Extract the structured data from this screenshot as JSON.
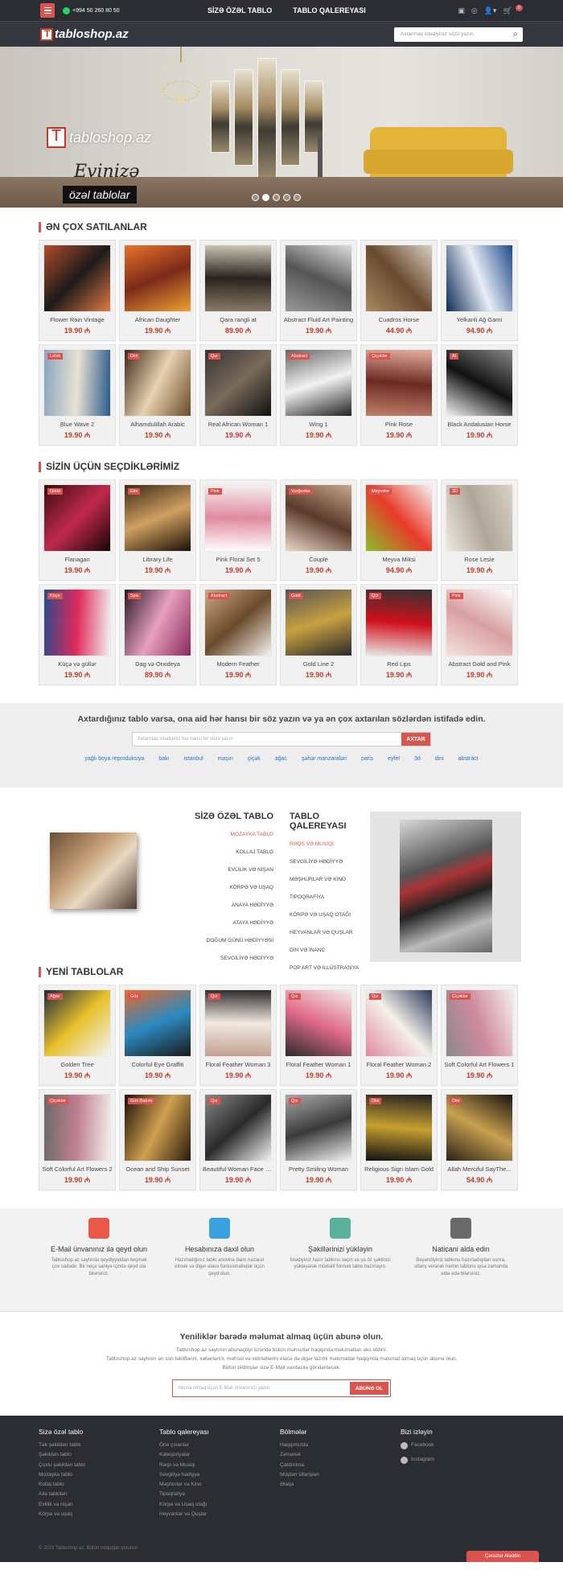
{
  "topbar": {
    "phone": "+994 50 260 80 50",
    "nav": [
      "SİZƏ ÖZƏL TABLO",
      "TABLO QALEREYASI"
    ],
    "cart_count": "0"
  },
  "header": {
    "logo_text": "tabloshop.az",
    "search_placeholder": "Axtarmaq istədiyiniz sözü yazın."
  },
  "hero": {
    "logo_text": "tabloshop.az",
    "line1": "Evinizə",
    "line2": "özəl tablolar"
  },
  "bestsellers": {
    "title": "ƏN ÇOX SATILANLAR",
    "products": [
      {
        "name": "Flower Rain Vintage",
        "price": "19.90 ₼",
        "badge": "",
        "colors": [
          "#b34a2a",
          "#1c1b1a",
          "#e07a44"
        ]
      },
      {
        "name": "African Daughter",
        "price": "19.90 ₼",
        "badge": "",
        "colors": [
          "#e8722a",
          "#7b2a1a",
          "#f0a030"
        ]
      },
      {
        "name": "Qara rangli at",
        "price": "89.90 ₼",
        "badge": "",
        "colors": [
          "#cfc7b6",
          "#2a231d",
          "#8a7a66"
        ]
      },
      {
        "name": "Abstract Fluid Art Painting",
        "price": "19.90 ₼",
        "badge": "",
        "colors": [
          "#ddd",
          "#555",
          "#999"
        ]
      },
      {
        "name": "Cuadros Horse",
        "price": "44.90 ₼",
        "badge": "",
        "colors": [
          "#d8cfc2",
          "#6a4a2e",
          "#a88a62"
        ]
      },
      {
        "name": "Yelkanli Ağ Gami",
        "price": "94.90 ₼",
        "badge": "",
        "colors": [
          "#1f4a8a",
          "#e8eef6",
          "#0d2a55"
        ]
      },
      {
        "name": "Blue Wave 2",
        "price": "19.90 ₼",
        "badge": "Lələk",
        "colors": [
          "#2a5a8a",
          "#e8e2d2",
          "#8aa6c0"
        ]
      },
      {
        "name": "Alhamdulillah Arabic",
        "price": "19.90 ₼",
        "badge": "Dini",
        "colors": [
          "#6a4a2a",
          "#e8d2b0",
          "#3a2a1a"
        ]
      },
      {
        "name": "Real African Woman 1",
        "price": "19.90 ₼",
        "badge": "Qız",
        "colors": [
          "#111",
          "#7a6a5a",
          "#333"
        ]
      },
      {
        "name": "Wing 1",
        "price": "19.90 ₼",
        "badge": "Abstract",
        "colors": [
          "#222",
          "#f2f2f2",
          "#666"
        ]
      },
      {
        "name": "Pink Rose",
        "price": "19.90 ₼",
        "badge": "Çiçəklər",
        "colors": [
          "#c0806a",
          "#6a2a22",
          "#e8b0a0"
        ]
      },
      {
        "name": "Black Andalusian Horse",
        "price": "19.90 ₼",
        "badge": "At",
        "colors": [
          "#f4f4f4",
          "#111",
          "#888"
        ]
      }
    ]
  },
  "picks": {
    "title": "SİZİN ÜÇÜN SEÇDİKLƏRİMİZ",
    "products": [
      {
        "name": "Flanagan",
        "price": "19.90 ₼",
        "badge": "Orkid",
        "colors": [
          "#3a0a12",
          "#c02a4a",
          "#1a0508"
        ]
      },
      {
        "name": "Library Life",
        "price": "19.90 ₼",
        "badge": "Elm",
        "colors": [
          "#3a2a18",
          "#d0a060",
          "#1a1208"
        ]
      },
      {
        "name": "Pink Floral Set 5",
        "price": "19.90 ₼",
        "badge": "Pink",
        "colors": [
          "#f4f0ee",
          "#e08aa0",
          "#fff"
        ]
      },
      {
        "name": "Couple",
        "price": "19.90 ₼",
        "badge": "Vurğunlar",
        "colors": [
          "#c8a88a",
          "#5a3a2a",
          "#e8d8c8"
        ]
      },
      {
        "name": "Meyva Miksi",
        "price": "94.90 ₼",
        "badge": "Meyvələr",
        "colors": [
          "#f4f4f4",
          "#e83a2a",
          "#8ac02a"
        ]
      },
      {
        "name": "Rose Lesie",
        "price": "19.90 ₼",
        "badge": "3D",
        "colors": [
          "#d8d2c8",
          "#b0a698",
          "#ece8e2"
        ]
      },
      {
        "name": "Küçə və güllər",
        "price": "19.90 ₼",
        "badge": "Küçə",
        "colors": [
          "#f2f2f2",
          "#e02a5a",
          "#2a4a8a"
        ]
      },
      {
        "name": "Dag və Orxideya",
        "price": "89.90 ₼",
        "badge": "Spa",
        "colors": [
          "#8a2a5a",
          "#e8a0c0",
          "#2a1a2a"
        ]
      },
      {
        "name": "Modern Feather",
        "price": "19.90 ₼",
        "badge": "Abstract",
        "colors": [
          "#f4f2ee",
          "#6a4a2a",
          "#c8a888"
        ]
      },
      {
        "name": "Gold Line 2",
        "price": "19.90 ₼",
        "badge": "Gold",
        "colors": [
          "#2a2a2a",
          "#c8a040",
          "#555"
        ]
      },
      {
        "name": "Red Lips",
        "price": "19.90 ₼",
        "badge": "Qız",
        "colors": [
          "#e8e8e8",
          "#d0101a",
          "#333"
        ]
      },
      {
        "name": "Abstract Gold and Pink",
        "price": "19.90 ₼",
        "badge": "Pink",
        "colors": [
          "#f4e2de",
          "#d8a0a0",
          "#fff"
        ]
      }
    ]
  },
  "search_band": {
    "heading": "Axtardığınız tablo varsa, ona aid hər hansı bir söz yazın və ya ən çox axtarılan sözlərdən istifadə edin.",
    "placeholder": "Axtarmaq istədiyiniz hər hansı bir sözü yazın",
    "button": "AXTAR",
    "tags": [
      "yağlı boya reproduksiya",
      "bakı",
      "istanbul",
      "maşın",
      "çiçək",
      "ağac",
      "şəhər manzaraləri",
      "paris",
      "eyfel",
      "3d",
      "dini",
      "abstract"
    ]
  },
  "menus": {
    "col1_title": "SİZƏ ÖZƏL TABLO",
    "col1": [
      "MOZAYKA TABLO",
      "KOLLAJ TABLO",
      "EVLİLİK VƏ NİŞAN",
      "KÖRPƏ VƏ UŞAQ",
      "ANAYA HƏDİYYƏ",
      "ATAYA HƏDİYYƏ",
      "DOĞUM GÜNÜ HƏDİYYƏSİ",
      "SEVGİLİYƏ HƏDİYYƏ"
    ],
    "col2_title": "TABLO QALEREYASI",
    "col2": [
      "RƏQS VƏ MUSİQİ",
      "SEVGİLİYƏ HƏDİYYƏ",
      "MƏŞHURLAR VƏ KİNO",
      "TİPOQRAFİYA",
      "KÖRPƏ VƏ UŞAQ OTAĞI",
      "HEYVANLAR VƏ QUŞLAR",
      "DİN VƏ İNANC",
      "POP ART VƏ İLLÜSTRASİYA"
    ]
  },
  "new_items": {
    "title": "YENİ TABLOLAR",
    "products": [
      {
        "name": "Golden Tree",
        "price": "19.90 ₼",
        "badge": "Ağac",
        "colors": [
          "#1a2a3a",
          "#e8c02a",
          "#f4f4f4"
        ]
      },
      {
        "name": "Colorful Eye Graffiti",
        "price": "19.90 ₼",
        "badge": "Göz",
        "colors": [
          "#e86a2a",
          "#2a8ac0",
          "#1a1a1a"
        ]
      },
      {
        "name": "Floral Feather Woman 3",
        "price": "19.90 ₼",
        "badge": "Qız",
        "colors": [
          "#2a2a2a",
          "#f4e8e2",
          "#c0a090"
        ]
      },
      {
        "name": "Floral Feather Woman 1",
        "price": "19.90 ₼",
        "badge": "Qız",
        "colors": [
          "#f2eeea",
          "#e06a8a",
          "#2a2a2a"
        ]
      },
      {
        "name": "Floral Feather Woman 2",
        "price": "19.90 ₼",
        "badge": "Qız",
        "colors": [
          "#2a3a5a",
          "#f4f0ea",
          "#e08aa0"
        ]
      },
      {
        "name": "Soft Colorful Art Flowers 1",
        "price": "19.90 ₼",
        "badge": "Çiçəklər",
        "colors": [
          "#f4eeea",
          "#d08aa0",
          "#8a8a8a"
        ]
      },
      {
        "name": "Soft Colorful Art Flowers 2",
        "price": "19.90 ₼",
        "badge": "Çiçəklər",
        "colors": [
          "#f2eeea",
          "#c08090",
          "#6a6a6a"
        ]
      },
      {
        "name": "Ocean and Ship Sunset",
        "price": "19.90 ₼",
        "badge": "Gün Batımı",
        "colors": [
          "#2a1a0a",
          "#d0a050",
          "#1a1008"
        ]
      },
      {
        "name": "Beautiful Woman Face Silhouette",
        "price": "19.90 ₼",
        "badge": "Qız",
        "colors": [
          "#f4f4f4",
          "#2a2a2a",
          "#888"
        ]
      },
      {
        "name": "Pretty Smiling Woman",
        "price": "19.90 ₼",
        "badge": "Qız",
        "colors": [
          "#f2f2f2",
          "#3a3a3a",
          "#aaa"
        ]
      },
      {
        "name": "Religious Sign Islam Gold",
        "price": "19.90 ₼",
        "badge": "Dini",
        "colors": [
          "#111",
          "#c8a030",
          "#222"
        ]
      },
      {
        "name": "Allah Merciful SayThe...",
        "price": "54.90 ₼",
        "badge": "Dini",
        "colors": [
          "#2a2218",
          "#c8a050",
          "#1a1410"
        ]
      }
    ]
  },
  "features": [
    {
      "title": "E-Mail ünvanınız ilə qeyd olun",
      "text": "Tabloshop.az saytında qeydiyyatdan keçmək çox sadədir. Bir neçə saniyə içində qeyd ola bilərsiniz.",
      "icon": "envelope-icon",
      "color": "#e8584a"
    },
    {
      "title": "Hesabınıza daxil olun",
      "text": "Hazırladığınız tablo arxivinə daim nəzarət etmək və digər əlavə funksionallıqlar üçün qeyd olun.",
      "icon": "user-icon",
      "color": "#3aa0e0"
    },
    {
      "title": "Şəkillərinizi yükləyin",
      "text": "İstədiyiniz hazır tablonu seçin və ya öz şəklinizi yükləyərək müxtəlif formalı tablo hazırlayın.",
      "icon": "upload-icon",
      "color": "#5ab09a"
    },
    {
      "title": "Naticani alda edin",
      "text": "Bəyəndiyiniz tablonu hazırladıqdan sonra, sifariş verərək həmin tablonu qısa zamanda əldə edə bilərsiniz.",
      "icon": "monitor-icon",
      "color": "#6a6a6a"
    }
  ],
  "newsletter": {
    "title": "Yeniliklər barədə məlumat almaq üçün abunə olun.",
    "line1": "Tabloshop.az saytının abunəçiliyi özündə bütün məhsullar haqqında məlumatları əks etdirir.",
    "line2": "Tabloshop.az saytının ən son təkliflərini, xəbərlərini, məhsul və xidmətlərini eləcə də digər lazımi məlumatlar haqqında məlumat almaq üçün abunə olun.",
    "line3": "Bütün bildirişlər sizə E-Mail vasitəsilə göndəriləcək.",
    "placeholder": "Abunə olmaq üçün E-Mail ünvanınızı yazın",
    "button": "ABUNƏ OL"
  },
  "footer": {
    "cols": [
      {
        "title": "Sizə özəl tablo",
        "items": [
          "Tək şəkildən tablo",
          "Şəkildən tablo",
          "Çoxlu şəkildən tablo",
          "Mozayka tablo",
          "Kollaj tablo",
          "Ailə tabloları",
          "Evlilik və nişan",
          "Körpə və uşaq"
        ]
      },
      {
        "title": "Tablo qalereyası",
        "items": [
          "Önə çıxanlar",
          "Kateqoriyalar",
          "Rəqs və Musiqi",
          "Sevgiliyə hədiyyə",
          "Məşhurlar və Kino",
          "Tipoqrafiya",
          "Körpə və Uşaq otağı",
          "Heyvanlar və Quşlar"
        ]
      },
      {
        "title": "Bölmələr",
        "items": [
          "Haqqımızda",
          "Zəmanət",
          "Çatdırılma",
          "Müştəri sifarişləri",
          "Əlaqə"
        ]
      },
      {
        "title": "Bizi izləyin",
        "items": [
          "Facebook",
          "Instagram"
        ]
      }
    ],
    "copyright": "© 2022 Tabloshop.az. Bütün hüquqlar qorunur.",
    "cookie": "Çərəzlər Aləddin"
  }
}
